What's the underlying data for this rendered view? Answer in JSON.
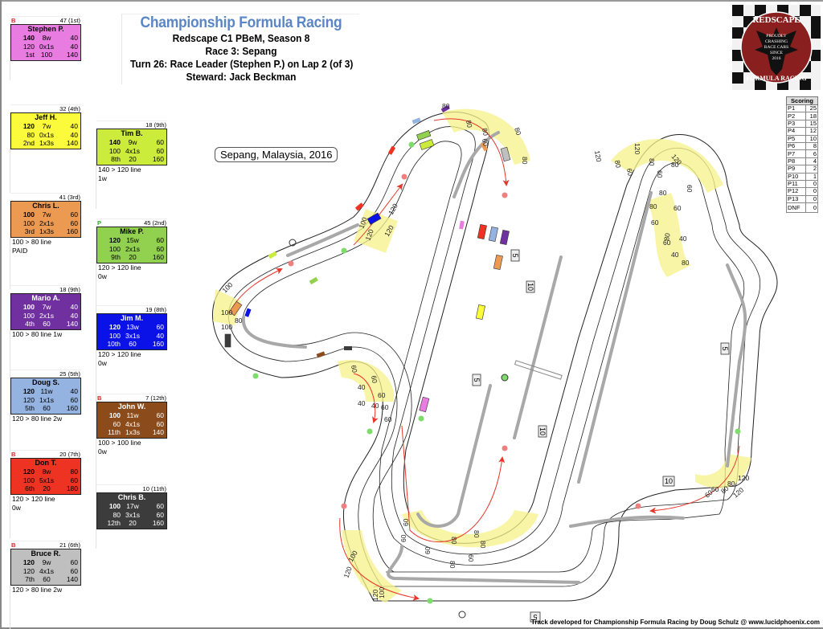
{
  "header": {
    "title": "Championship Formula Racing",
    "league": "Redscape C1 PBeM, Season 8",
    "race": "Race 3: Sepang",
    "turn": "Turn 26: Race Leader (Stephen P.) on Lap 2 (of 3)",
    "steward": "Steward: Jack Beckman"
  },
  "logo": {
    "top_text": "REDSCAPE",
    "bottom_text": "FORMULA RACING",
    "motto": [
      "PROUDLY",
      "CRASHING",
      "RACE CARS",
      "SINCE",
      "2016"
    ],
    "colors": {
      "circle": "#8a1f1f",
      "eagle": "#111111"
    }
  },
  "location_label": "Sepang, Malaysia, 2016",
  "scoring": {
    "title": "Scoring",
    "rows": [
      {
        "pos": "P1",
        "pts": "25"
      },
      {
        "pos": "P2",
        "pts": "18"
      },
      {
        "pos": "P3",
        "pts": "15"
      },
      {
        "pos": "P4",
        "pts": "12"
      },
      {
        "pos": "P5",
        "pts": "10"
      },
      {
        "pos": "P6",
        "pts": "8"
      },
      {
        "pos": "P7",
        "pts": "6"
      },
      {
        "pos": "P8",
        "pts": "4"
      },
      {
        "pos": "P9",
        "pts": "2"
      },
      {
        "pos": "P10",
        "pts": "1"
      },
      {
        "pos": "P11",
        "pts": "0"
      },
      {
        "pos": "P12",
        "pts": "0"
      },
      {
        "pos": "P13",
        "pts": "0"
      },
      {
        "pos": "DNF",
        "pts": "0"
      }
    ]
  },
  "drivers": [
    {
      "flag": "B",
      "points": "47 (1st)",
      "name": "Stephen P.",
      "rows": [
        [
          "140",
          "8w",
          "40"
        ],
        [
          "120",
          "0x1s",
          "40"
        ],
        [
          "1st",
          "100",
          "140"
        ]
      ],
      "notes": [],
      "color": "#e87ce0",
      "text": "#000000"
    },
    {
      "flag": "",
      "points": "32 (4th)",
      "name": "Jeff H.",
      "rows": [
        [
          "120",
          "7w",
          "40"
        ],
        [
          "80",
          "0x1s",
          "40"
        ],
        [
          "2nd",
          "1x3s",
          "140"
        ]
      ],
      "notes": [],
      "color": "#fbfb3c",
      "text": "#000000"
    },
    {
      "flag": "",
      "points": "18 (9th)",
      "name": "Tim B.",
      "rows": [
        [
          "140",
          "9w",
          "60"
        ],
        [
          "100",
          "4x1s",
          "60"
        ],
        [
          "8th",
          "20",
          "160"
        ]
      ],
      "notes": [
        "140 > 120 line",
        "1w"
      ],
      "color": "#ccec3c",
      "text": "#000000"
    },
    {
      "flag": "",
      "points": "41 (3rd)",
      "name": "Chris L.",
      "rows": [
        [
          "100",
          "7w",
          "60"
        ],
        [
          "100",
          "2x1s",
          "60"
        ],
        [
          "3rd",
          "1x3s",
          "160"
        ]
      ],
      "notes": [
        "100 > 80 line",
        "PAID"
      ],
      "color": "#ec9a52",
      "text": "#000000"
    },
    {
      "flag": "P",
      "points": "45 (2nd)",
      "name": "Mike P.",
      "rows": [
        [
          "120",
          "15w",
          "60"
        ],
        [
          "100",
          "2x1s",
          "60"
        ],
        [
          "9th",
          "20",
          "160"
        ]
      ],
      "notes": [
        "120 > 120 line",
        "0w"
      ],
      "color": "#92d050",
      "text": "#000000"
    },
    {
      "flag": "",
      "points": "18 (9th)",
      "name": "Mario A.",
      "rows": [
        [
          "100",
          "7w",
          "40"
        ],
        [
          "100",
          "2x1s",
          "40"
        ],
        [
          "4th",
          "60",
          "140"
        ]
      ],
      "notes": [
        "100 > 80 line 1w"
      ],
      "color": "#7030a0",
      "text": "#ffffff"
    },
    {
      "flag": "",
      "points": "19 (8th)",
      "name": "Jim M.",
      "rows": [
        [
          "120",
          "13w",
          "60"
        ],
        [
          "100",
          "3x1s",
          "40"
        ],
        [
          "10th",
          "60",
          "160"
        ]
      ],
      "notes": [
        "120 > 120 line",
        "0w"
      ],
      "color": "#0b12e8",
      "text": "#ffffff"
    },
    {
      "flag": "",
      "points": "25 (5th)",
      "name": "Doug S.",
      "rows": [
        [
          "120",
          "11w",
          "40"
        ],
        [
          "120",
          "1x1s",
          "60"
        ],
        [
          "5th",
          "60",
          "160"
        ]
      ],
      "notes": [
        "120 > 80 line 2w"
      ],
      "color": "#95b3e0",
      "text": "#000000"
    },
    {
      "flag": "B",
      "points": "7 (12th)",
      "name": "John W.",
      "rows": [
        [
          "100",
          "11w",
          "60"
        ],
        [
          "60",
          "4x1s",
          "60"
        ],
        [
          "11th",
          "1x3s",
          "140"
        ]
      ],
      "notes": [
        "100 > 100 line",
        "0w"
      ],
      "color": "#8b4b1a",
      "text": "#ffffff"
    },
    {
      "flag": "B",
      "points": "20 (7th)",
      "name": "Don T.",
      "rows": [
        [
          "120",
          "8w",
          "80"
        ],
        [
          "100",
          "5x1s",
          "60"
        ],
        [
          "6th",
          "20",
          "180"
        ]
      ],
      "notes": [
        "120 > 120 line",
        "0w"
      ],
      "color": "#ee3322",
      "text": "#000000"
    },
    {
      "flag": "",
      "points": "10 (11th)",
      "name": "Chris B.",
      "rows": [
        [
          "100",
          "17w",
          "60"
        ],
        [
          "80",
          "3x1s",
          "60"
        ],
        [
          "12th",
          "20",
          "160"
        ]
      ],
      "notes": [],
      "color": "#3c3c3c",
      "text": "#ffffff"
    },
    {
      "flag": "B",
      "points": "21 (6th)",
      "name": "Bruce R.",
      "rows": [
        [
          "120",
          "9w",
          "60"
        ],
        [
          "120",
          "4x1s",
          "60"
        ],
        [
          "7th",
          "60",
          "140"
        ]
      ],
      "notes": [
        "120 > 80 line 2w"
      ],
      "color": "#bfbfbf",
      "text": "#000000"
    }
  ],
  "track": {
    "corner_speeds": {
      "turn1": [
        "120",
        "100",
        "120",
        "100"
      ],
      "turn2": [
        "100",
        "100",
        "80",
        "100"
      ],
      "turn3": [
        "120",
        "120",
        "100",
        "120"
      ],
      "turn4": [
        "80",
        "80",
        "80",
        "60",
        "80",
        "80"
      ],
      "turn5": [
        "60",
        "60",
        "40",
        "60",
        "40",
        "40",
        "60",
        "60"
      ],
      "turn6": [
        "60",
        "60",
        "60",
        "80",
        "80",
        "80",
        "60",
        "80"
      ],
      "turn7": [
        "120",
        "80",
        "60",
        "120",
        "80",
        "60",
        "120",
        "80",
        "60"
      ],
      "turn8": [
        "60",
        "80",
        "120",
        "60",
        "80",
        "120"
      ],
      "turn9": [
        "80",
        "80",
        "40",
        "40",
        "60",
        "80",
        "80",
        "60",
        "60"
      ]
    },
    "markers": [
      "5",
      "10",
      "5",
      "10",
      "5",
      "10",
      "5"
    ],
    "colors": {
      "corner": "#f7f28a",
      "barrier": "#a8a8a8",
      "move_arrow": "#e8352b",
      "green_dot": "#7ddc6a",
      "red_dot": "#f08080"
    }
  },
  "footer": "Track developed for Championship Formula Racing by Doug Schulz @ www.lucidphoenix.com"
}
